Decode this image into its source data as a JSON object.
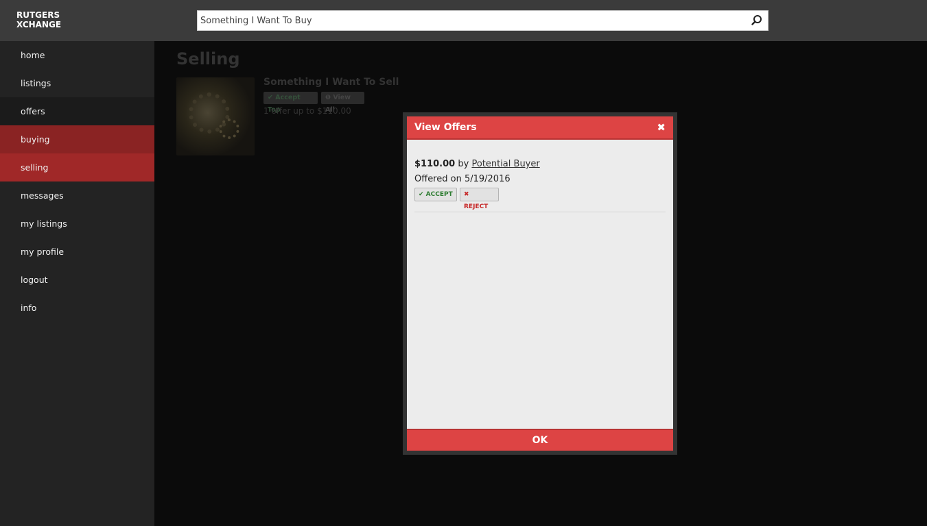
{
  "header": {
    "logo_line1": "RUTGERS",
    "logo_line2": "XCHANGE",
    "search_value": "Something I Want To Buy"
  },
  "sidebar": {
    "items": [
      {
        "label": "home"
      },
      {
        "label": "listings"
      },
      {
        "label": "offers"
      },
      {
        "label": "buying"
      },
      {
        "label": "selling"
      },
      {
        "label": "messages"
      },
      {
        "label": "my listings"
      },
      {
        "label": "my profile"
      },
      {
        "label": "logout"
      },
      {
        "label": "info"
      }
    ]
  },
  "main": {
    "title": "Selling",
    "listing": {
      "title": "Something I Want To Sell",
      "accept_top_label": "✔ Accept Top",
      "view_all_label": "❶ View All",
      "summary": "1 offer up to $110.00"
    }
  },
  "modal": {
    "title": "View Offers",
    "close_glyph": "✖",
    "offer": {
      "amount": "$110.00",
      "by_text": " by ",
      "buyer": "Potential Buyer",
      "date_text": "Offered on 5/19/2016",
      "accept_label": "✔ ACCEPT",
      "reject_label": "✖ REJECT"
    },
    "ok_label": "OK"
  },
  "colors": {
    "header_bg": "#3b3b3b",
    "sidebar_bg": "#232323",
    "accent_red": "#dd4444",
    "buying_bg": "#8a2323",
    "selling_bg": "#a02828"
  }
}
